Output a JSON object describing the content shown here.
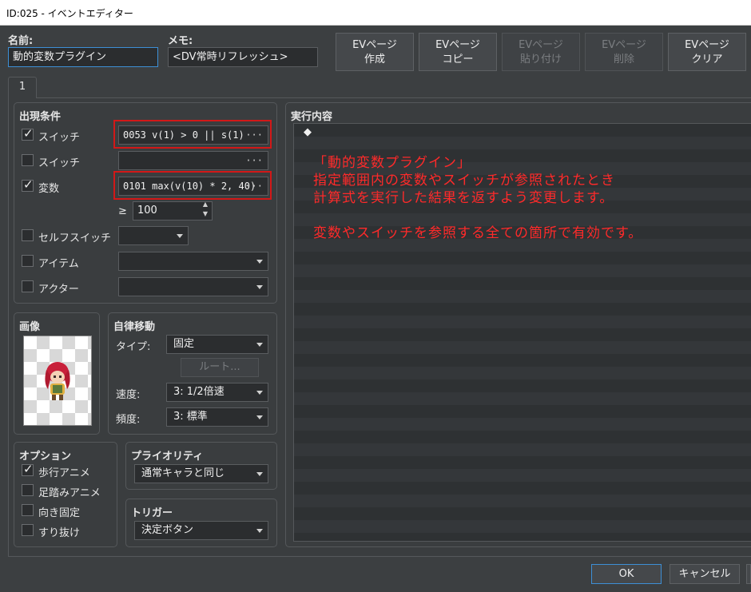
{
  "window": {
    "title": "ID:025 - イベントエディター"
  },
  "header": {
    "name_label": "名前:",
    "name_value": "動的変数プラグイン",
    "memo_label": "メモ:",
    "memo_value": "<DV常時リフレッシュ>"
  },
  "ev_buttons": [
    {
      "line1": "EVページ",
      "line2": "作成",
      "enabled": true
    },
    {
      "line1": "EVページ",
      "line2": "コピー",
      "enabled": true
    },
    {
      "line1": "EVページ",
      "line2": "貼り付け",
      "enabled": false
    },
    {
      "line1": "EVページ",
      "line2": "削除",
      "enabled": false
    },
    {
      "line1": "EVページ",
      "line2": "クリア",
      "enabled": true
    }
  ],
  "tabs": [
    "1"
  ],
  "conditions": {
    "title": "出現条件",
    "switch1": {
      "label": "スイッチ",
      "checked": true,
      "value": "0053 v(1) > 0 || s(1)",
      "dots": "···"
    },
    "switch2": {
      "label": "スイッチ",
      "checked": false,
      "value": "",
      "dots": "···"
    },
    "variable": {
      "label": "変数",
      "checked": true,
      "value": "0101 max(v(10) * 2, 40)",
      "dots": "···",
      "operator": "≥",
      "number": "100"
    },
    "self_switch": {
      "label": "セルフスイッチ",
      "checked": false,
      "value": ""
    },
    "item": {
      "label": "アイテム",
      "checked": false,
      "value": ""
    },
    "actor": {
      "label": "アクター",
      "checked": false,
      "value": ""
    }
  },
  "image": {
    "title": "画像"
  },
  "autonomous": {
    "title": "自律移動",
    "type_label": "タイプ:",
    "type_value": "固定",
    "route_button": "ルート...",
    "speed_label": "速度:",
    "speed_value": "3: 1/2倍速",
    "freq_label": "頻度:",
    "freq_value": "3: 標準"
  },
  "options": {
    "title": "オプション",
    "items": [
      {
        "label": "歩行アニメ",
        "checked": true
      },
      {
        "label": "足踏みアニメ",
        "checked": false
      },
      {
        "label": "向き固定",
        "checked": false
      },
      {
        "label": "すり抜け",
        "checked": false
      }
    ]
  },
  "priority": {
    "title": "プライオリティ",
    "value": "通常キャラと同じ"
  },
  "trigger": {
    "title": "トリガー",
    "value": "決定ボタン"
  },
  "execution": {
    "title": "実行内容",
    "bullet": "◆",
    "comment_lines": [
      "「動的変数プラグイン」",
      "指定範囲内の変数やスイッチが参照されたとき",
      "計算式を実行した結果を返すよう変更します。",
      "",
      "変数やスイッチを参照する全ての箇所で有効です。"
    ]
  },
  "footer": {
    "ok": "OK",
    "cancel": "キャンセル"
  },
  "colors": {
    "background": "#3c3f41",
    "comment_text": "#ff2a2a",
    "highlight_box": "#d21818",
    "focus_border": "#3d8fd6"
  }
}
